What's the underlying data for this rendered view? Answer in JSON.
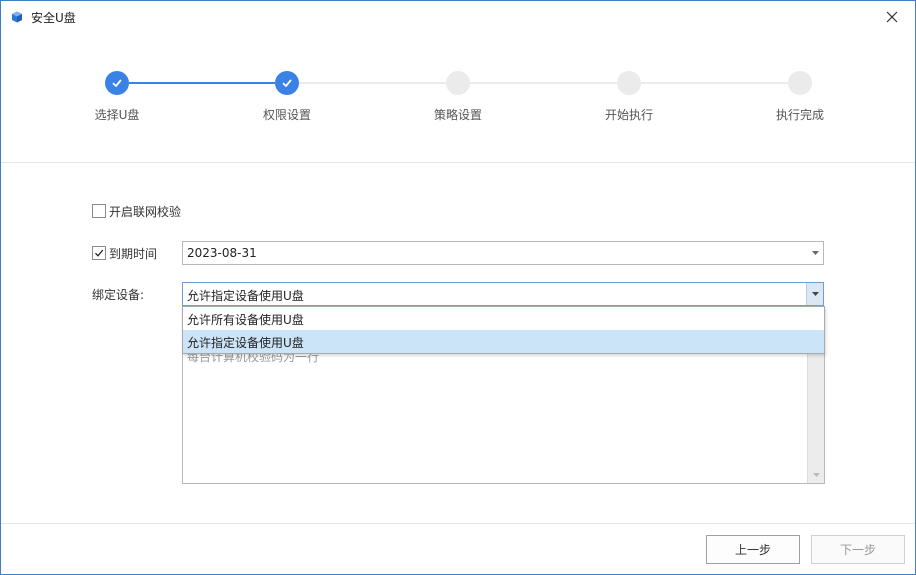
{
  "window": {
    "title": "安全U盘"
  },
  "steps": [
    {
      "label": "选择U盘",
      "status": "done"
    },
    {
      "label": "权限设置",
      "status": "done"
    },
    {
      "label": "策略设置",
      "status": "todo"
    },
    {
      "label": "开始执行",
      "status": "todo"
    },
    {
      "label": "执行完成",
      "status": "todo"
    }
  ],
  "form": {
    "network_check": {
      "label": "开启联网校验",
      "checked": false
    },
    "expire": {
      "label": "到期时间",
      "checked": true,
      "value": "2023-08-31"
    },
    "bind": {
      "label": "绑定设备:",
      "value": "允许指定设备使用U盘",
      "options": [
        "允许所有设备使用U盘",
        "允许指定设备使用U盘"
      ],
      "selected_index": 1
    },
    "device_codes": {
      "placeholder": "每台计算机校验码为一行"
    }
  },
  "buttons": {
    "prev": "上一步",
    "next": "下一步"
  },
  "colors": {
    "accent": "#3b82e6",
    "step_todo": "#ebebeb",
    "highlight": "#cce4f7"
  }
}
